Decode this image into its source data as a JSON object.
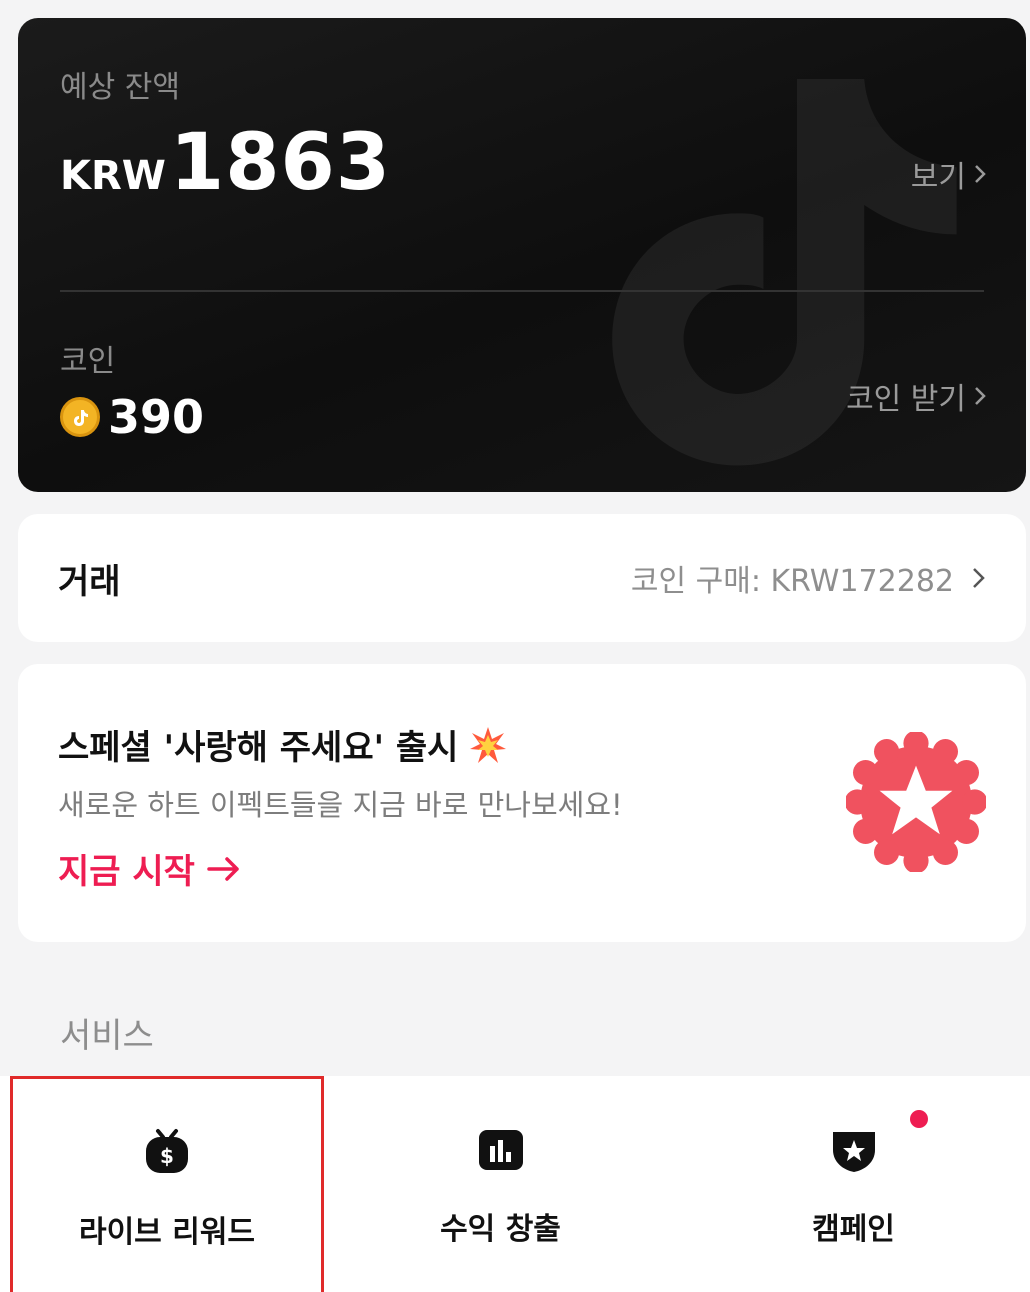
{
  "balance": {
    "label": "예상 잔액",
    "currency": "KRW",
    "amount": "1863",
    "view_label": "보기"
  },
  "coins": {
    "label": "코인",
    "value": "390",
    "get_label": "코인 받기"
  },
  "transaction": {
    "title": "거래",
    "summary": "코인 구매: KRW172282"
  },
  "promo": {
    "title": "스페셜 '사랑해 주세요' 출시",
    "subtitle": "새로운 하트 이펙트들을 지금 바로 만나보세요!",
    "cta": "지금 시작"
  },
  "services": {
    "title": "서비스",
    "items": [
      {
        "label": "라이브 리워드",
        "icon": "tv-dollar-icon"
      },
      {
        "label": "수익 창출",
        "icon": "bar-chart-icon"
      },
      {
        "label": "캠페인",
        "icon": "shield-star-icon"
      }
    ]
  },
  "colors": {
    "accent": "#ee1d52",
    "coin": "#f3b424",
    "highlight_border": "#e02a2a"
  }
}
